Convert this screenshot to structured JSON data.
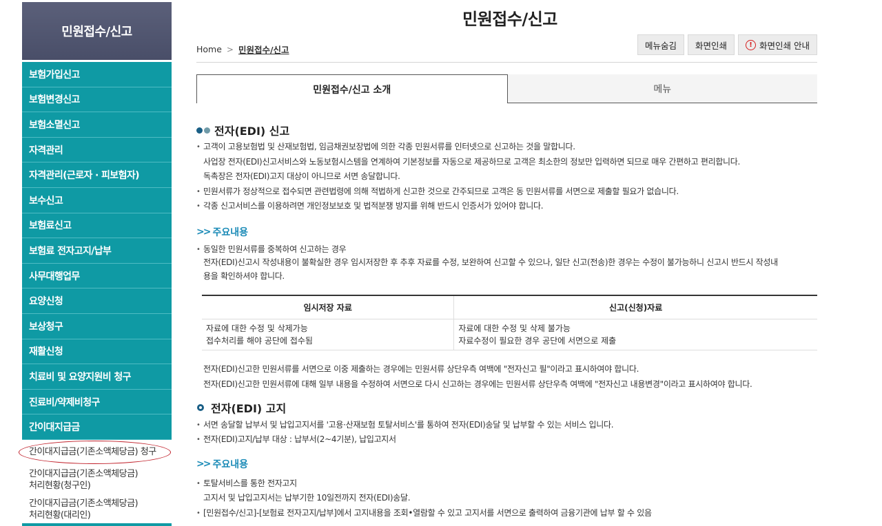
{
  "sidebar": {
    "title": "민원접수/신고",
    "items": [
      {
        "label": "보험가입신고"
      },
      {
        "label": "보험변경신고"
      },
      {
        "label": "보험소멸신고"
      },
      {
        "label": "자격관리"
      },
      {
        "label": "자격관리(근로자 · 피보험자)"
      },
      {
        "label": "보수신고"
      },
      {
        "label": "보험료신고"
      },
      {
        "label": "보험료 전자고지/납부"
      },
      {
        "label": "사무대행업무"
      },
      {
        "label": "요양신청"
      },
      {
        "label": "보상청구"
      },
      {
        "label": "재활신청"
      },
      {
        "label": "치료비 및 요양지원비 청구"
      },
      {
        "label": "진료비/약제비청구"
      },
      {
        "label": "간이대지급금"
      }
    ],
    "subitems": [
      {
        "label": "간이대지급금(기존소액체당금) 청구"
      },
      {
        "line1": "간이대지급금(기존소액체당금)",
        "line2": "처리현황(청구인)"
      },
      {
        "line1": "간이대지급금(기존소액체당금)",
        "line2": "처리현황(대리인)"
      }
    ]
  },
  "header": {
    "title": "민원접수/신고",
    "breadcrumb": {
      "home": "Home",
      "current": "민원접수/신고"
    },
    "buttons": {
      "hide_menu": "메뉴숨김",
      "print": "화면인쇄",
      "print_guide": "화면인쇄 안내"
    }
  },
  "tabs": [
    {
      "label": "민원접수/신고 소개",
      "active": true
    },
    {
      "label": "메뉴",
      "active": false
    }
  ],
  "sections": {
    "edi_report": {
      "title": "전자(EDI) 신고",
      "lines": [
        "고객이 고용보험법 및 산재보험법, 임금채권보장법에 의한 각종 민원서류를 인터넷으로 신고하는 것을 말합니다.",
        "사업장 전자(EDI)신고서비스와 노동보험시스템을 연계하여 기본정보를 자동으로 제공하므로 고객은 최소한의 정보만 입력하면 되므로 매우 간편하고 편리합니다.",
        "독촉장은 전자(EDI)고지 대상이 아니므로 서면 송달합니다.",
        "민원서류가 정상적으로 접수되면 관련법령에 의해 적법하게 신고한 것으로 간주되므로 고객은 동 민원서류를 서면으로 제출할 필요가 없습니다.",
        "각종 신고서비스를 이용하려면 개인정보보호 및 법적분쟁 방지를 위해 반드시 인증서가 있어야 합니다."
      ],
      "main_title": "주요내용",
      "main_lines": [
        "동일한 민원서류를 중복하여 신고하는 경우",
        "전자(EDI)신고시 작성내용이 불확실한 경우 임시저장한 후 추후 자료를 수정, 보완하여 신고할 수 있으나, 일단 신고(전송)한 경우는 수정이 불가능하니 신고시 반드시 작성내",
        "용을 확인하셔야 합니다."
      ],
      "table": {
        "headers": [
          "임시저장 자료",
          "신고(신청)자료"
        ],
        "col1": [
          "자료에 대한 수정 및 삭제가능",
          "접수처리를 해야 공단에 접수됨"
        ],
        "col2": [
          "자료에 대한 수정 및 삭제 불가능",
          "자료수정이 필요한 경우 공단에 서면으로 제출"
        ]
      },
      "after_lines": [
        "전자(EDI)신고한 민원서류를 서면으로 이중 제출하는 경우에는 민원서류 상단우측 여백에 \"전자신고 필\"이라고 표시하여야 합니다.",
        "전자(EDI)신고한 민원서류에 대해 일부 내용을 수정하여 서면으로 다시 신고하는 경우에는 민원서류 상단우측 여백에 \"전자신고 내용변경\"이라고 표시하여야 합니다."
      ]
    },
    "edi_notice": {
      "title": "전자(EDI) 고지",
      "lines": [
        "서면 송달할 납부서 및 납입고지서를 '고용·산재보험 토탈서비스'를 통하여 전자(EDI)송달 및 납부할 수 있는 서비스 입니다.",
        "전자(EDI)고지/납부 대상 : 납부서(2~4기분), 납입고지서"
      ],
      "main_title": "주요내용",
      "main_lines": [
        "토탈서비스를 통한 전자고지",
        "고지서 및 납입고지서는 납부기한 10일전까지 전자(EDI)송달.",
        "[민원접수/신고]-[보험료 전자고지/납부]에서 고지내용을 조회•열람할 수 있고 고지서를 서면으로 출력하여 금융기관에 납부 할 수 있음"
      ]
    }
  },
  "colors": {
    "sidebar_teal": "#0f9aa4",
    "sidebar_head": "#494e68",
    "accent_blue": "#1b8bb7",
    "dot_dark": "#1a5f86",
    "dot_light": "#6f9aa8",
    "circle_red": "#c0202a"
  }
}
